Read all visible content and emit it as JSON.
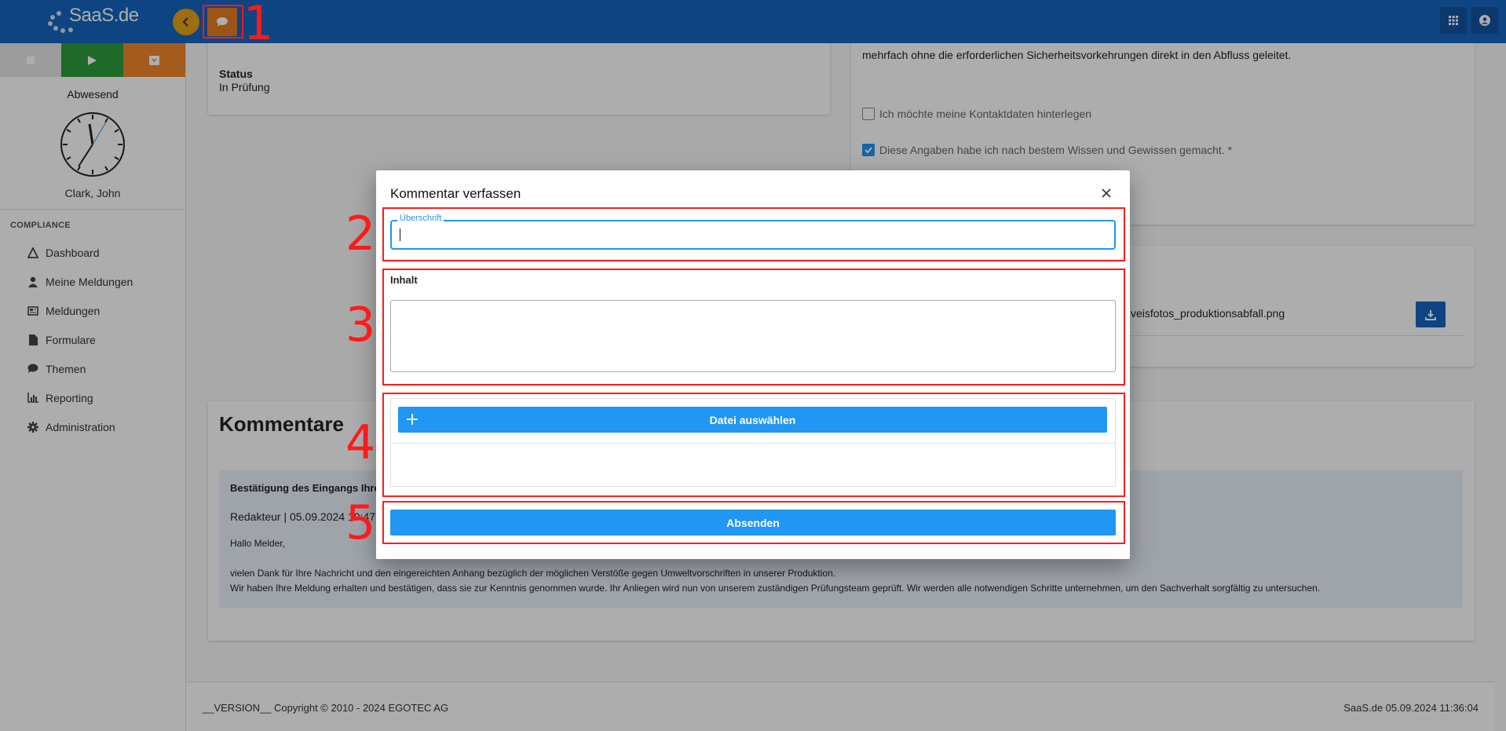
{
  "topbar": {
    "logo": "SaaS.de",
    "back_icon": "chevron-left-icon",
    "comment_icon": "comment-icon",
    "apps_icon": "grid-icon",
    "user_icon": "user-circle-icon"
  },
  "sidebar": {
    "presence": "Abwesend",
    "user": "Clark, John",
    "section": "COMPLIANCE",
    "items": [
      {
        "label": "Dashboard",
        "icon": "sitemap-icon"
      },
      {
        "label": "Meine Meldungen",
        "icon": "user-icon"
      },
      {
        "label": "Meldungen",
        "icon": "newspaper-icon"
      },
      {
        "label": "Formulare",
        "icon": "file-icon"
      },
      {
        "label": "Themen",
        "icon": "comment-icon"
      },
      {
        "label": "Reporting",
        "icon": "chart-icon"
      },
      {
        "label": "Administration",
        "icon": "gear-icon"
      }
    ]
  },
  "background": {
    "status_label": "Status",
    "status_value": "In Prüfung",
    "partial_text": "mehrfach ohne die erforderlichen Sicherheitsvorkehrungen direkt in den Abfluss geleitet.",
    "checkbox1": "Ich möchte meine Kontaktdaten hinterlegen",
    "checkbox2": "Diese Angaben habe ich nach bestem Wissen und Gewissen gemacht. *",
    "file_name": "veisfotos_produktionsabfall.png",
    "comments_title": "Kommentare",
    "comment_subject": "Bestätigung des Eingangs Ihre",
    "comment_meta": "Redakteur | 05.09.2024 10:47",
    "comment_greeting": "Hallo Melder,",
    "comment_body1": "vielen Dank für Ihre Nachricht und den eingereichten Anhang bezüglich der möglichen Verstöße gegen Umweltvorschriften in unserer Produktion.",
    "comment_body2": "Wir haben Ihre Meldung erhalten und bestätigen, dass sie zur Kenntnis genommen wurde. Ihr Anliegen wird nun von unserem zuständigen Prüfungsteam geprüft. Wir werden alle notwendigen Schritte unternehmen, um den Sachverhalt sorgfältig zu untersuchen."
  },
  "footer": {
    "left": "__VERSION__ Copyright © 2010 - 2024 EGOTEC AG",
    "right": "SaaS.de  05.09.2024 11:36:04"
  },
  "modal": {
    "title": "Kommentar verfassen",
    "heading_label": "Überschrift",
    "heading_value": "",
    "content_label": "Inhalt",
    "content_value": "",
    "file_button": "Datei auswählen",
    "submit_button": "Absenden"
  },
  "annotations": [
    "1",
    "2",
    "3",
    "4",
    "5"
  ],
  "colors": {
    "topbar": "#1565c0",
    "primary": "#2196f3",
    "highlight": "#ff1a1a",
    "play": "#2e9d3c",
    "pause": "#f2862c"
  }
}
